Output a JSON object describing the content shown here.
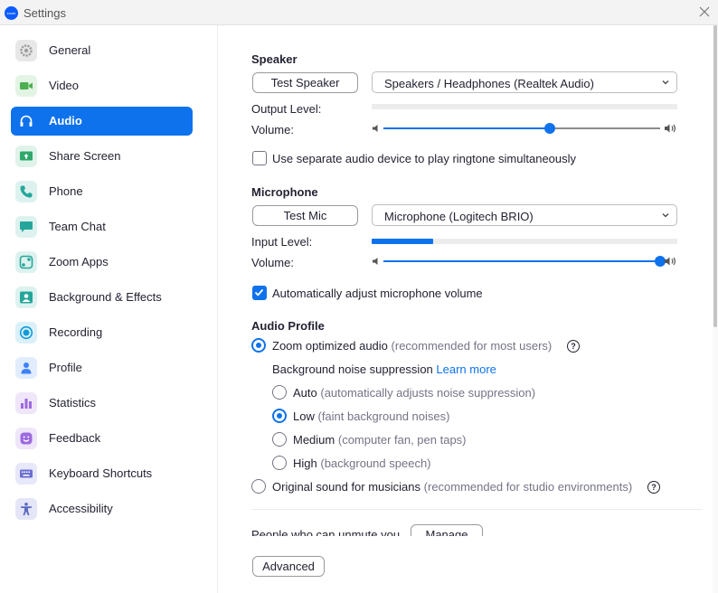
{
  "window": {
    "title": "Settings",
    "logo_text": "zoom"
  },
  "colors": {
    "accent": "#0e72ed",
    "sidebar_active_bg": "#0e72ed"
  },
  "sidebar": {
    "items": [
      {
        "label": "General",
        "icon": "gear-icon",
        "color": "#9e9e9e",
        "active": false
      },
      {
        "label": "Video",
        "icon": "video-camera-icon",
        "color": "#4caf50",
        "active": false
      },
      {
        "label": "Audio",
        "icon": "headphones-icon",
        "color": "#0e72ed",
        "active": true
      },
      {
        "label": "Share Screen",
        "icon": "share-screen-icon",
        "color": "#2fa86c",
        "active": false
      },
      {
        "label": "Phone",
        "icon": "phone-icon",
        "color": "#26a69a",
        "active": false
      },
      {
        "label": "Team Chat",
        "icon": "chat-icon",
        "color": "#26a69a",
        "active": false
      },
      {
        "label": "Zoom Apps",
        "icon": "apps-icon",
        "color": "#26a69a",
        "active": false
      },
      {
        "label": "Background & Effects",
        "icon": "person-background-icon",
        "color": "#26a69a",
        "active": false
      },
      {
        "label": "Recording",
        "icon": "record-icon",
        "color": "#0e9bd8",
        "active": false
      },
      {
        "label": "Profile",
        "icon": "profile-icon",
        "color": "#3b82f6",
        "active": false
      },
      {
        "label": "Statistics",
        "icon": "bar-chart-icon",
        "color": "#9c6ade",
        "active": false
      },
      {
        "label": "Feedback",
        "icon": "smiley-icon",
        "color": "#9c6ade",
        "active": false
      },
      {
        "label": "Keyboard Shortcuts",
        "icon": "keyboard-icon",
        "color": "#6b6fd1",
        "active": false
      },
      {
        "label": "Accessibility",
        "icon": "accessibility-icon",
        "color": "#5c6bc0",
        "active": false
      }
    ]
  },
  "speaker": {
    "heading": "Speaker",
    "test_button": "Test Speaker",
    "device": "Speakers / Headphones (Realtek Audio)",
    "output_level_label": "Output Level:",
    "output_level": 0,
    "volume_label": "Volume:",
    "volume": 0.6
  },
  "ringtone": {
    "label": "Use separate audio device to play ringtone simultaneously",
    "checked": false
  },
  "microphone": {
    "heading": "Microphone",
    "test_button": "Test Mic",
    "device": "Microphone (Logitech BRIO)",
    "input_level_label": "Input Level:",
    "input_level": 0.2,
    "volume_label": "Volume:",
    "volume": 1.0
  },
  "auto_adjust": {
    "label": "Automatically adjust microphone volume",
    "checked": true
  },
  "audio_profile": {
    "heading": "Audio Profile",
    "zoom_optimized": {
      "label": "Zoom optimized audio",
      "hint": "(recommended for most users)",
      "selected": true
    },
    "noise_suppression": {
      "label": "Background noise suppression",
      "link": "Learn more",
      "options": [
        {
          "label": "Auto",
          "hint": "(automatically adjusts noise suppression)",
          "selected": false
        },
        {
          "label": "Low",
          "hint": "(faint background noises)",
          "selected": true
        },
        {
          "label": "Medium",
          "hint": "(computer fan, pen taps)",
          "selected": false
        },
        {
          "label": "High",
          "hint": "(background speech)",
          "selected": false
        }
      ]
    },
    "original_sound": {
      "label": "Original sound for musicians",
      "hint": "(recommended for studio environments)",
      "selected": false
    }
  },
  "unmute": {
    "label": "People who can unmute you",
    "button": "Manage"
  },
  "advanced_button": "Advanced"
}
